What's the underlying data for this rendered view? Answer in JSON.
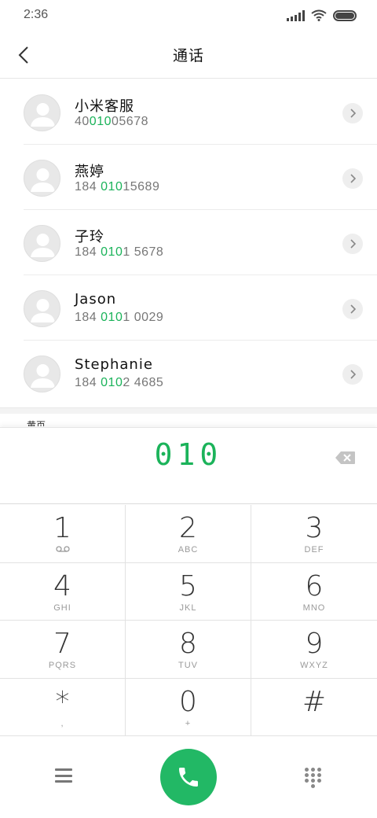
{
  "status_bar": {
    "time": "2:36"
  },
  "header": {
    "title": "通话"
  },
  "contacts": [
    {
      "name": "小米客服",
      "number_prefix": "40",
      "number_match": "010",
      "number_suffix": "05678"
    },
    {
      "name": "燕婷",
      "number_prefix": "184 ",
      "number_match": "010",
      "number_suffix": "15689"
    },
    {
      "name": "子玲",
      "number_prefix": "184 ",
      "number_match": "010",
      "number_suffix": "1 5678"
    },
    {
      "name": "Jason",
      "number_prefix": "184 ",
      "number_match": "010",
      "number_suffix": "1 0029"
    },
    {
      "name": "Stephanie",
      "number_prefix": "184 ",
      "number_match": "010",
      "number_suffix": "2 4685"
    }
  ],
  "section_label": "黄页",
  "dialer": {
    "digits": "010"
  },
  "keys": [
    {
      "digit": "1",
      "sub": ""
    },
    {
      "digit": "2",
      "sub": "ABC"
    },
    {
      "digit": "3",
      "sub": "DEF"
    },
    {
      "digit": "4",
      "sub": "GHI"
    },
    {
      "digit": "5",
      "sub": "JKL"
    },
    {
      "digit": "6",
      "sub": "MNO"
    },
    {
      "digit": "7",
      "sub": "PQRS"
    },
    {
      "digit": "8",
      "sub": "TUV"
    },
    {
      "digit": "9",
      "sub": "WXYZ"
    },
    {
      "digit": "*",
      "sub": ","
    },
    {
      "digit": "0",
      "sub": "+"
    },
    {
      "digit": "#",
      "sub": ""
    }
  ],
  "colors": {
    "accent": "#1bb35a",
    "call_button": "#22b865"
  },
  "icons": {
    "back": "chevron-left-icon",
    "detail": "chevron-right-icon",
    "backspace": "backspace-icon",
    "voicemail": "voicemail-icon",
    "call": "phone-icon",
    "menu": "menu-icon",
    "keypad": "dialpad-icon"
  }
}
